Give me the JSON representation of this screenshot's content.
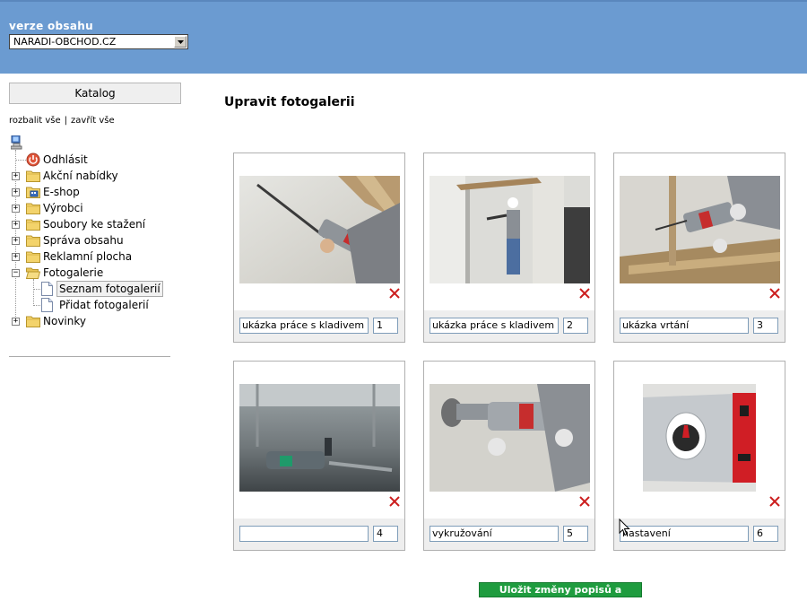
{
  "header": {
    "version_label": "verze obsahu",
    "version_selected": "NARADI-OBCHOD.CZ",
    "brand_color": "#6b9bd1"
  },
  "sidebar": {
    "catalog_button": "Katalog",
    "expand_all": "rozbalit vše",
    "separator": "|",
    "collapse_all": "zavřít vše",
    "tree": [
      {
        "label": "Odhlásit",
        "icon": "logout-icon"
      },
      {
        "label": "Akční nabídky",
        "icon": "folder-icon"
      },
      {
        "label": "E-shop",
        "icon": "eshop-folder-icon"
      },
      {
        "label": "Výrobci",
        "icon": "folder-icon"
      },
      {
        "label": "Soubory ke stažení",
        "icon": "folder-icon"
      },
      {
        "label": "Správa obsahu",
        "icon": "folder-icon"
      },
      {
        "label": "Reklamní plocha",
        "icon": "folder-icon"
      },
      {
        "label": "Fotogalerie",
        "icon": "folder-open-icon"
      },
      {
        "label": "Seznam fotogalerií",
        "icon": "page-icon",
        "selected": true
      },
      {
        "label": "Přidat fotogalerií",
        "icon": "page-icon"
      },
      {
        "label": "Novinky",
        "icon": "folder-icon"
      }
    ]
  },
  "main": {
    "title": "Upravit fotogalerii",
    "photos": [
      {
        "description": "ukázka práce s kladivem",
        "order": "1"
      },
      {
        "description": "ukázka práce s kladivem",
        "order": "2"
      },
      {
        "description": "ukázka vrtání",
        "order": "3"
      },
      {
        "description": "",
        "order": "4"
      },
      {
        "description": "vykružování",
        "order": "5"
      },
      {
        "description": "nastavení",
        "order": "6"
      }
    ],
    "save_button": "Uložit změny popisů a pořadí"
  }
}
